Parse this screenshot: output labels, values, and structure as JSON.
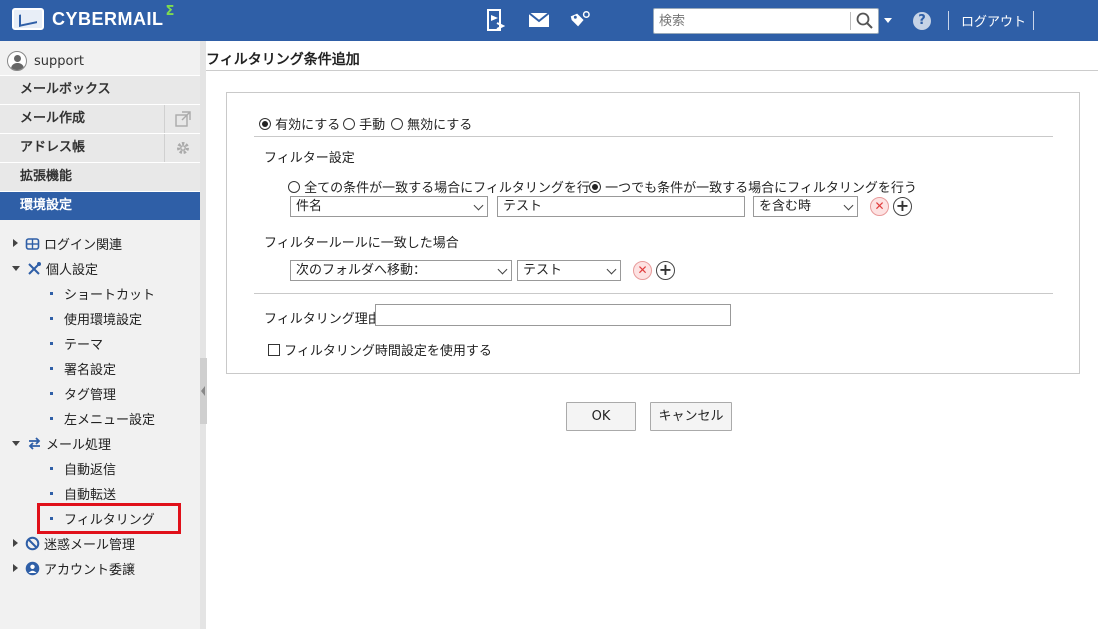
{
  "app": {
    "logo_text": "CYBERMAIL",
    "logo_mark": "Σ"
  },
  "topbar": {
    "icons": [
      "send-receive-icon",
      "mail-icon",
      "tag-gear-icon"
    ],
    "search": {
      "placeholder": "検索",
      "value": ""
    },
    "help_label": "?",
    "logout_label": "ログアウト"
  },
  "sidebar": {
    "user": "support",
    "nav": [
      {
        "label": "メールボックス"
      },
      {
        "label": "メール作成",
        "side_icon": "external-link-icon"
      },
      {
        "label": "アドレス帳",
        "side_icon": "gear-icon"
      },
      {
        "label": "拡張機能"
      },
      {
        "label": "環境設定",
        "active": true
      }
    ],
    "tree": [
      {
        "label": "ログイン関連",
        "icon": "login-icon",
        "expanded": false
      },
      {
        "label": "個人設定",
        "icon": "tools-icon",
        "expanded": true,
        "children": [
          "ショートカット",
          "使用環境設定",
          "テーマ",
          "署名設定",
          "タグ管理",
          "左メニュー設定"
        ]
      },
      {
        "label": "メール処理",
        "icon": "mail-process-icon",
        "expanded": true,
        "children": [
          "自動返信",
          "自動転送",
          "フィルタリング"
        ]
      },
      {
        "label": "迷惑メール管理",
        "icon": "block-icon",
        "expanded": false
      },
      {
        "label": "アカウント委譲",
        "icon": "account-icon",
        "expanded": false
      }
    ]
  },
  "main": {
    "title": "フィルタリング条件追加",
    "status_options": [
      {
        "label": "有効にする",
        "checked": true
      },
      {
        "label": "手動",
        "checked": false
      },
      {
        "label": "無効にする",
        "checked": false
      }
    ],
    "filter_settings_label": "フィルター設定",
    "match_options": [
      {
        "label": "全ての条件が一致する場合にフィルタリングを行う",
        "checked": false
      },
      {
        "label": "一つでも条件が一致する場合にフィルタリングを行う",
        "checked": true
      }
    ],
    "condition": {
      "field": "件名",
      "value": "テスト",
      "operator": "を含む時"
    },
    "action_label": "フィルタールールに一致した場合",
    "action": {
      "type": "次のフォルダへ移動：",
      "folder": "テスト"
    },
    "reason_label": "フィルタリング理由",
    "reason_value": "",
    "time_setting_label": "フィルタリング時間設定を使用する",
    "time_setting_checked": false,
    "ok_label": "OK",
    "cancel_label": "キャンセル"
  }
}
